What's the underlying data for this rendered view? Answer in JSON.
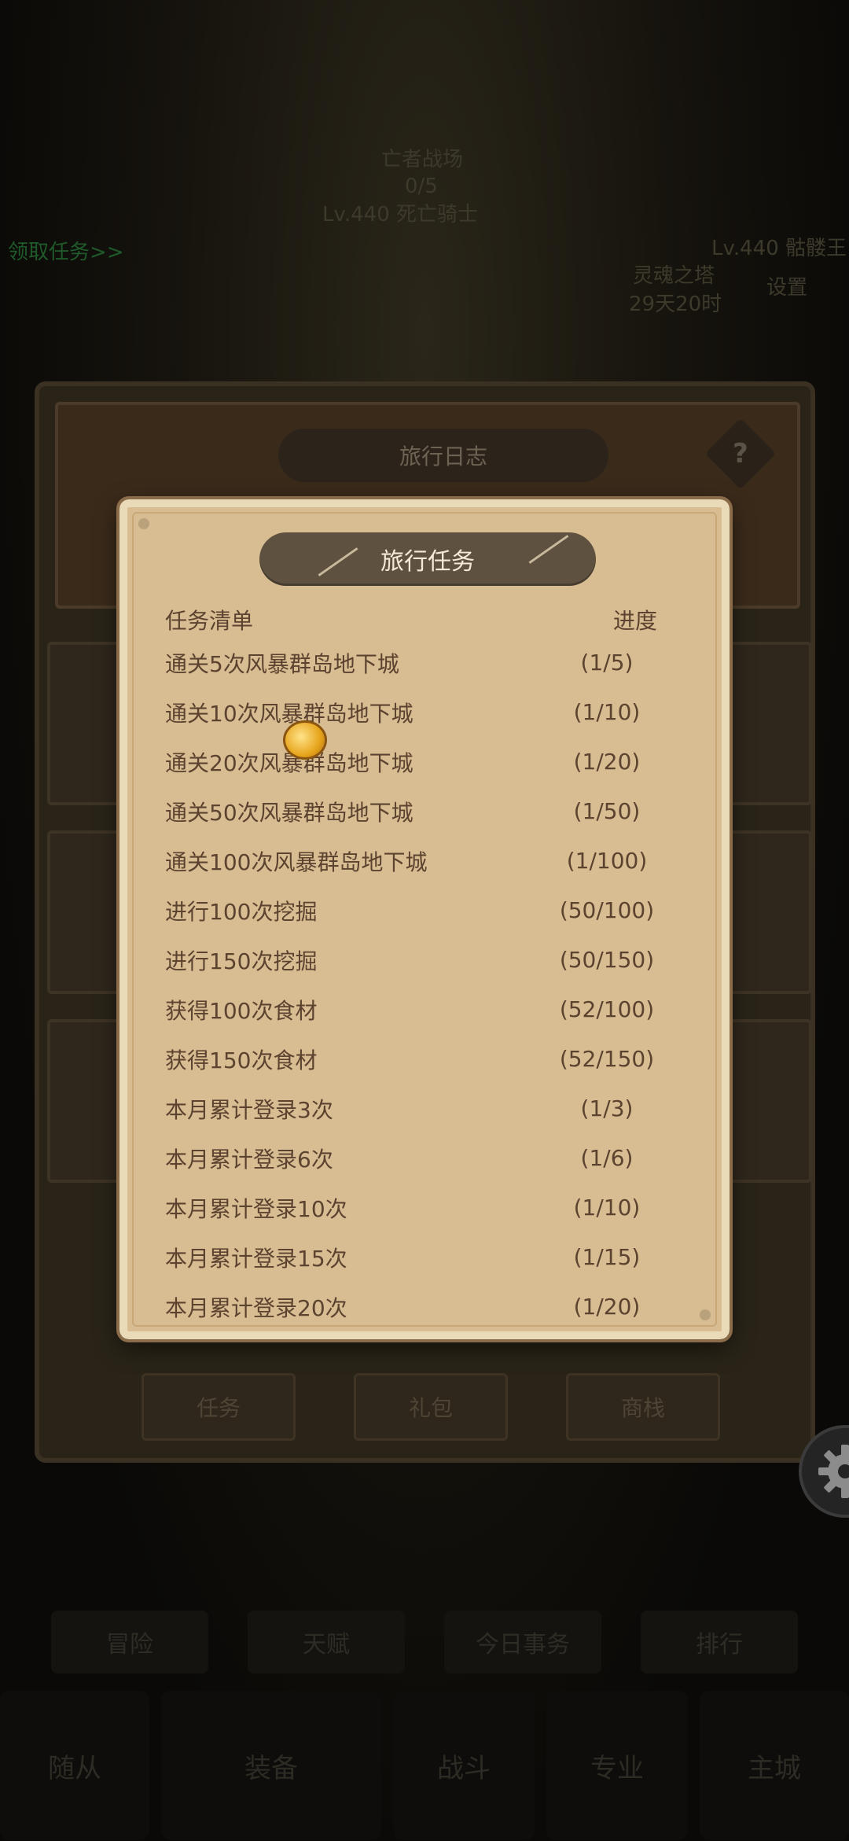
{
  "background": {
    "zone_title": "亡者战场",
    "zone_count": "0/5",
    "boss_label": "Lv.440 死亡骑士",
    "left_hint": "领取任务>>",
    "right_name": "Lv.440 骷髅王",
    "tower_name": "灵魂之塔",
    "timer": "29天20时",
    "right_sub": "设置",
    "outer_title": "旅行日志",
    "help_symbol": "?",
    "bottom_tabs": [
      "任务",
      "礼包",
      "商栈"
    ],
    "nav_row": [
      "冒险",
      "天赋",
      "今日事务",
      "排行"
    ],
    "bottom_nav": [
      "随从",
      "装备",
      "战斗",
      "专业",
      "主城"
    ]
  },
  "modal": {
    "title": "旅行任务",
    "col_task": "任务清单",
    "col_progress": "进度",
    "tasks": [
      {
        "name": "通关5次风暴群岛地下城",
        "progress": "(1/5)"
      },
      {
        "name": "通关10次风暴群岛地下城",
        "progress": "(1/10)"
      },
      {
        "name": "通关20次风暴群岛地下城",
        "progress": "(1/20)"
      },
      {
        "name": "通关50次风暴群岛地下城",
        "progress": "(1/50)"
      },
      {
        "name": "通关100次风暴群岛地下城",
        "progress": "(1/100)"
      },
      {
        "name": "进行100次挖掘",
        "progress": "(50/100)"
      },
      {
        "name": "进行150次挖掘",
        "progress": "(50/150)"
      },
      {
        "name": "获得100次食材",
        "progress": "(52/100)"
      },
      {
        "name": "获得150次食材",
        "progress": "(52/150)"
      },
      {
        "name": "本月累计登录3次",
        "progress": "(1/3)"
      },
      {
        "name": "本月累计登录6次",
        "progress": "(1/6)"
      },
      {
        "name": "本月累计登录10次",
        "progress": "(1/10)"
      },
      {
        "name": "本月累计登录15次",
        "progress": "(1/15)"
      },
      {
        "name": "本月累计登录20次",
        "progress": "(1/20)"
      }
    ]
  },
  "colors": {
    "modal_bg": "#d9bd92",
    "title_pill": "#5e5140",
    "text": "#5b4330"
  }
}
